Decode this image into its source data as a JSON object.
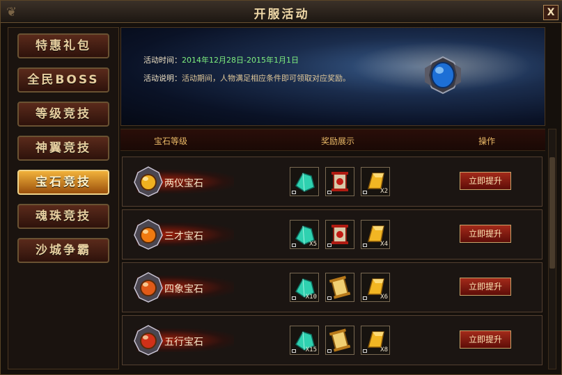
{
  "window": {
    "title": "开服活动",
    "close_label": "X"
  },
  "sidebar": {
    "items": [
      {
        "label": "特惠礼包",
        "active": false
      },
      {
        "label": "全民BOSS",
        "active": false
      },
      {
        "label": "等级竞技",
        "active": false
      },
      {
        "label": "神翼竞技",
        "active": false
      },
      {
        "label": "宝石竞技",
        "active": true
      },
      {
        "label": "魂珠竞技",
        "active": false
      },
      {
        "label": "沙城争霸",
        "active": false
      }
    ]
  },
  "banner": {
    "time_label": "活动时间：",
    "time_value": "2014年12月28日-2015年1月1日",
    "desc_label": "活动说明：",
    "desc_value": "活动期间，人物满足相应条件即可领取对应奖励。",
    "icon": "blue-gem-emblem-icon"
  },
  "table": {
    "headers": [
      "宝石等级",
      "奖励展示",
      "操作"
    ],
    "rows": [
      {
        "name": "两仪宝石",
        "gem_color": "#f0b020",
        "rewards": [
          {
            "icon": "green-crystal-icon",
            "qty": ""
          },
          {
            "icon": "red-scroll-icon",
            "qty": ""
          },
          {
            "icon": "gold-bar-icon",
            "qty": "X2"
          }
        ],
        "button": "立即提升"
      },
      {
        "name": "三才宝石",
        "gem_color": "#f07a10",
        "rewards": [
          {
            "icon": "green-crystal-icon",
            "qty": "X5"
          },
          {
            "icon": "red-scroll-icon",
            "qty": ""
          },
          {
            "icon": "gold-bar-icon",
            "qty": "X4"
          }
        ],
        "button": "立即提升"
      },
      {
        "name": "四象宝石",
        "gem_color": "#e05a18",
        "rewards": [
          {
            "icon": "green-crystal-icon",
            "qty": "X10"
          },
          {
            "icon": "gold-scroll-icon",
            "qty": ""
          },
          {
            "icon": "gold-bar-icon",
            "qty": "X6"
          }
        ],
        "button": "立即提升"
      },
      {
        "name": "五行宝石",
        "gem_color": "#d03018",
        "rewards": [
          {
            "icon": "green-crystal-icon",
            "qty": "X15"
          },
          {
            "icon": "gold-scroll-icon",
            "qty": ""
          },
          {
            "icon": "gold-bar-icon",
            "qty": "X8"
          }
        ],
        "button": "立即提升"
      }
    ]
  }
}
